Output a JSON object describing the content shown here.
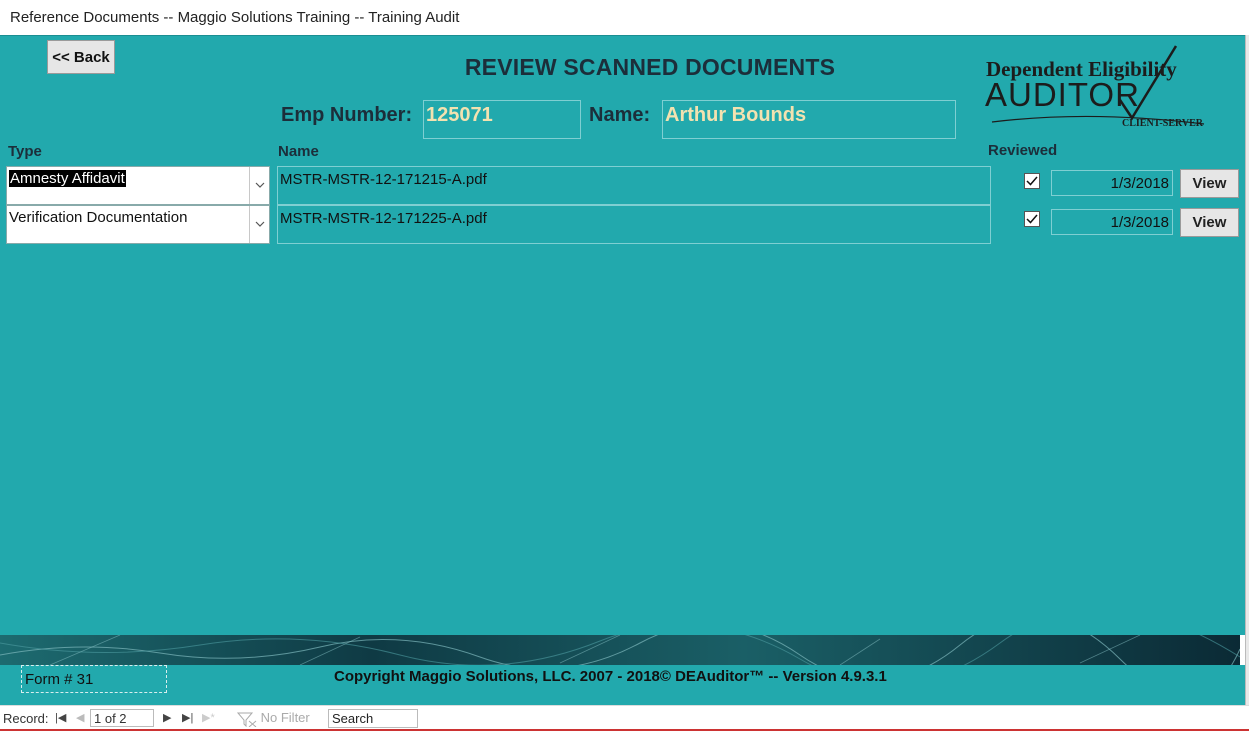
{
  "window": {
    "title": "Reference Documents -- Maggio Solutions Training -- Training Audit"
  },
  "form": {
    "back_label": "<< Back",
    "heading": "REVIEW SCANNED DOCUMENTS",
    "emp_number_label": "Emp Number:",
    "emp_number": "125071",
    "name_label": "Name:",
    "name": "Arthur Bounds",
    "columns": {
      "type": "Type",
      "name": "Name",
      "reviewed": "Reviewed"
    },
    "rows": [
      {
        "type": "Amnesty Affidavit",
        "file": "MSTR-MSTR-12-171215-A.pdf",
        "reviewed": true,
        "date": "1/3/2018",
        "view_label": "View"
      },
      {
        "type": "Verification Documentation",
        "file": "MSTR-MSTR-12-171225-A.pdf",
        "reviewed": true,
        "date": "1/3/2018",
        "view_label": "View"
      }
    ]
  },
  "logo": {
    "line1": "Dependent Eligibility",
    "line2": "AUDITOR",
    "line3": "CLIENT-SERVER"
  },
  "footer": {
    "form_number": "Form # 31",
    "copyright": "Copyright Maggio Solutions, LLC. 2007 - 2018©   DEAuditor™   -- Version  4.9.3.1"
  },
  "navbar": {
    "record_label": "Record:",
    "record_position": "1 of 2",
    "filter_label": "No Filter",
    "search_label": "Search"
  },
  "colors": {
    "form_bg": "#22a9ad",
    "field_text": "#f3e2b0",
    "heading": "#1c2e3a"
  }
}
